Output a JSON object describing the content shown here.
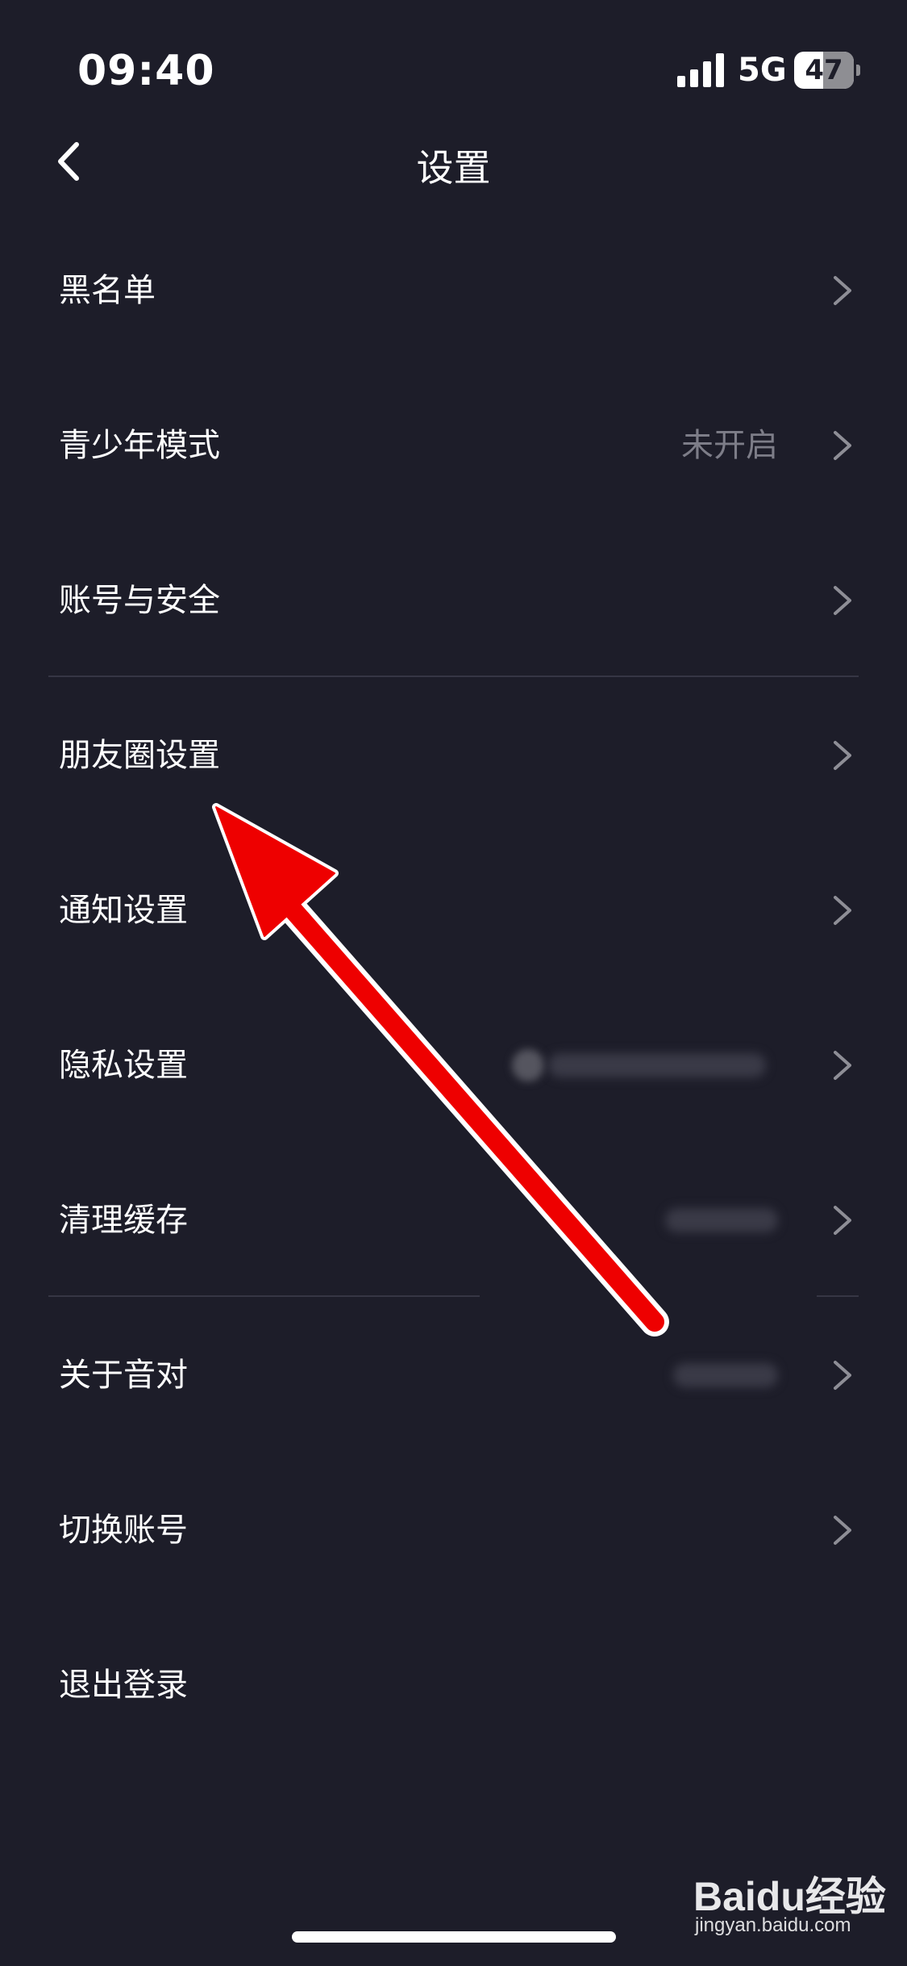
{
  "status_bar": {
    "time": "09:40",
    "network": "5G",
    "battery": "47",
    "battery_level_percent": 47
  },
  "nav": {
    "title": "设置",
    "back_icon": "chevron-left-icon"
  },
  "settings": {
    "items": [
      {
        "label": "黑名单"
      },
      {
        "label": "青少年模式",
        "value": "未开启"
      },
      {
        "label": "账号与安全"
      },
      {
        "label": "朋友圈设置"
      },
      {
        "label": "通知设置"
      },
      {
        "label": "隐私设置"
      },
      {
        "label": "清理缓存"
      },
      {
        "label": "关于音对"
      },
      {
        "label": "切换账号"
      },
      {
        "label": "退出登录"
      }
    ],
    "chevron_icon": "chevron-right-icon"
  },
  "colors": {
    "background": "#1d1d29",
    "text": "#ffffff",
    "secondary_text": "#7d7d88",
    "divider": "#363644",
    "annotation_arrow": "#ee0000"
  },
  "watermark": {
    "logo": "Baidu经验",
    "url": "jingyan.baidu.com"
  }
}
